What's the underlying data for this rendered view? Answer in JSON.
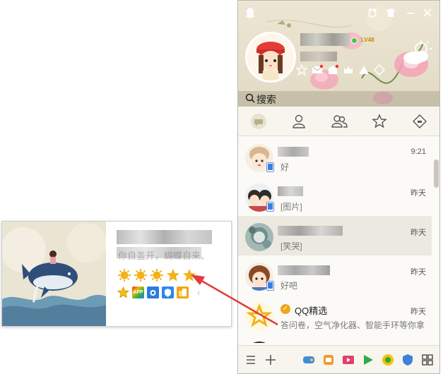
{
  "window": {
    "level_badge": "LV48",
    "search_label": "搜索",
    "title_buttons": [
      "skin-icon",
      "minimize-icon",
      "close-icon"
    ]
  },
  "tabs": [
    "chat-bubble-icon",
    "contact-icon",
    "group-icon",
    "star-icon",
    "diamond-icon"
  ],
  "conversations": [
    {
      "time": "9:21",
      "message": "好"
    },
    {
      "time": "昨天",
      "message": "[图片]"
    },
    {
      "time": "昨天",
      "message": "[笑哭]"
    },
    {
      "time": "昨天",
      "message": "好吧"
    },
    {
      "title": "QQ精选",
      "time": "昨天",
      "message": "答问卷，空气净化器、智能手环等你拿"
    }
  ],
  "bottom_icons": [
    "menu-icon",
    "add-icon",
    "game-icon",
    "app-icon",
    "video-icon",
    "music-icon",
    "store-icon",
    "app-grid-icon"
  ],
  "popup": {
    "signature": "你自盖开，蝴蝶自来。",
    "level_icons": [
      "sun",
      "sun",
      "sun",
      "star",
      "star"
    ],
    "service_icons": [
      "vip-star",
      "app",
      "camera",
      "shield",
      "coin"
    ]
  },
  "colors": {
    "accent_arrow": "#e23b3b",
    "online": "#4cc34a",
    "level_gold": "#f2b21b"
  }
}
